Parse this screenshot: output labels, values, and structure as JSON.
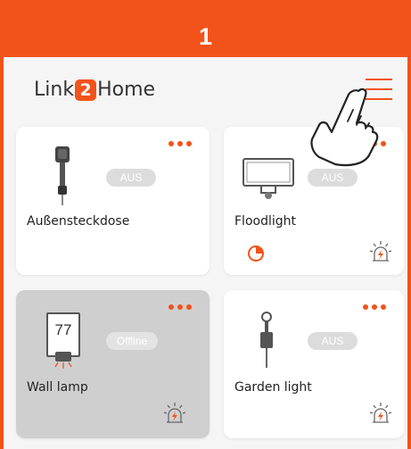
{
  "step": {
    "number": "1"
  },
  "header": {
    "logo_prefix": "Link",
    "logo_number": "2",
    "logo_suffix": "Home"
  },
  "colors": {
    "accent": "#f2531b",
    "badge": "#dcdcdc",
    "offline_card": "#cfcfcf"
  },
  "devices": [
    {
      "name": "Außensteckdose",
      "status": "AUS",
      "icon": "outdoor-socket-icon"
    },
    {
      "name": "Floodlight",
      "status": "AUS",
      "icon": "floodlight-icon",
      "timer_icon": "timer-pie-icon",
      "sensor_icon": "motion-sensor-icon"
    },
    {
      "name": "Wall lamp",
      "status": "Offline",
      "display_value": "77",
      "icon": "wall-lamp-icon",
      "sensor_icon": "motion-sensor-icon"
    },
    {
      "name": "Garden light",
      "status": "AUS",
      "icon": "garden-light-icon",
      "sensor_icon": "motion-sensor-icon"
    }
  ]
}
